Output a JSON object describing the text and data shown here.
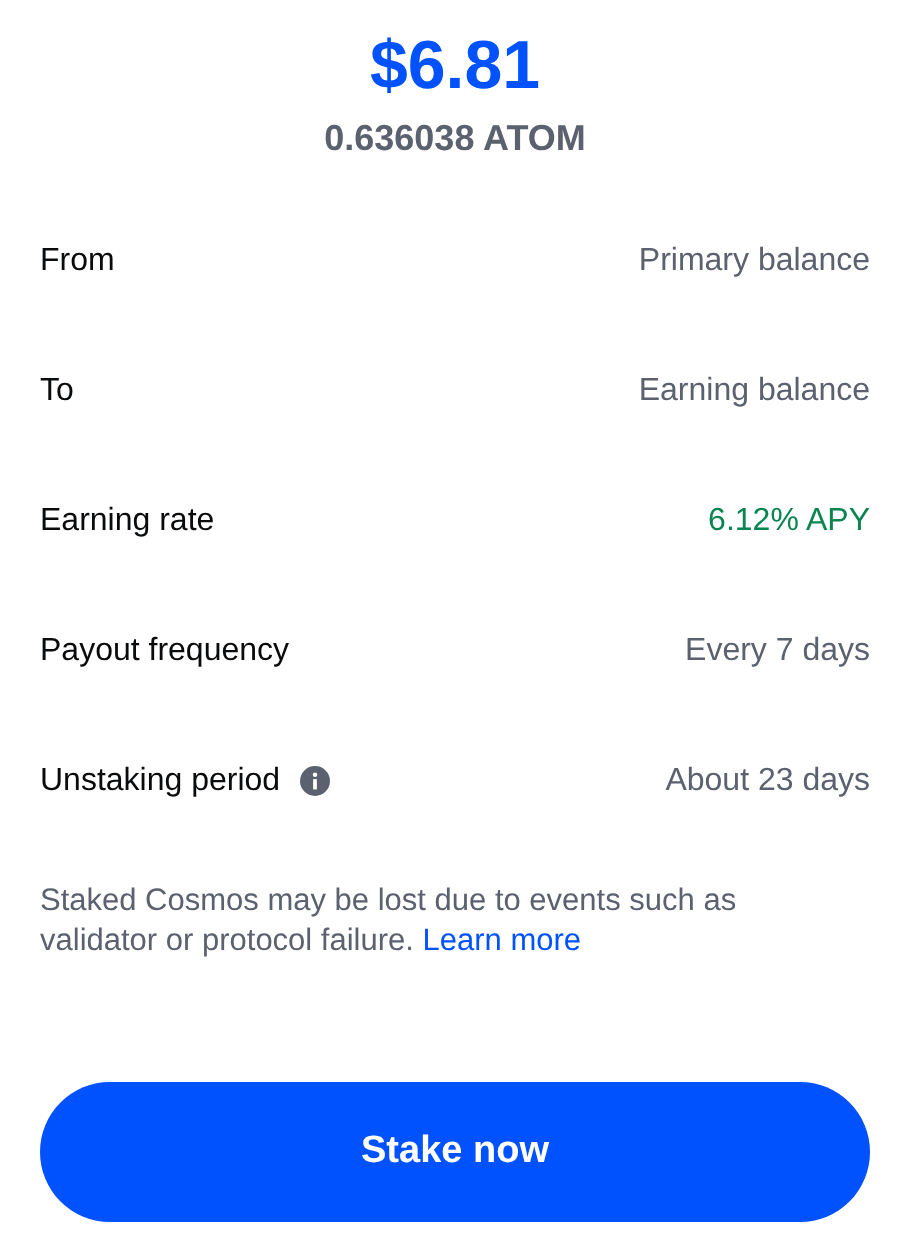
{
  "amount": {
    "fiat": "$6.81",
    "crypto": "0.636038 ATOM"
  },
  "details": [
    {
      "label": "From",
      "value": "Primary balance",
      "info": false
    },
    {
      "label": "To",
      "value": "Earning balance",
      "info": false
    },
    {
      "label": "Earning rate",
      "value": "6.12% APY",
      "info": false,
      "color": "#098551"
    },
    {
      "label": "Payout frequency",
      "value": "Every 7 days",
      "info": false
    },
    {
      "label": "Unstaking period",
      "value": "About 23 days",
      "info": true
    }
  ],
  "disclaimer": {
    "text": "Staked Cosmos may be lost due to events such as validator or protocol failure.",
    "link": "Learn more"
  },
  "button": "Stake now"
}
